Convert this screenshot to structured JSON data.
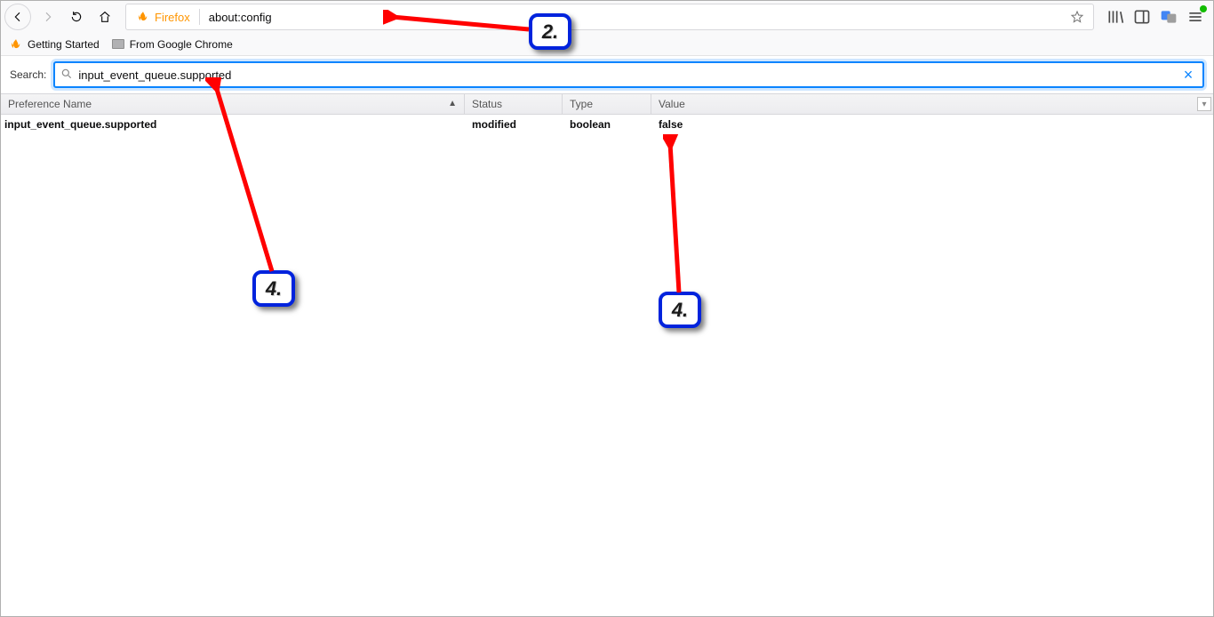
{
  "toolbar": {
    "firefox_label": "Firefox",
    "url": "about:config"
  },
  "bookmarks": [
    {
      "label": "Getting Started",
      "icon": "flame"
    },
    {
      "label": "From Google Chrome",
      "icon": "folder"
    }
  ],
  "search": {
    "label": "Search:",
    "value": "input_event_queue.supported"
  },
  "columns": {
    "name": "Preference Name",
    "status": "Status",
    "type": "Type",
    "value": "Value"
  },
  "rows": [
    {
      "name": "input_event_queue.supported",
      "status": "modified",
      "type": "boolean",
      "value": "false"
    }
  ],
  "annotations": {
    "b2": "2.",
    "b4a": "4.",
    "b4b": "4."
  }
}
